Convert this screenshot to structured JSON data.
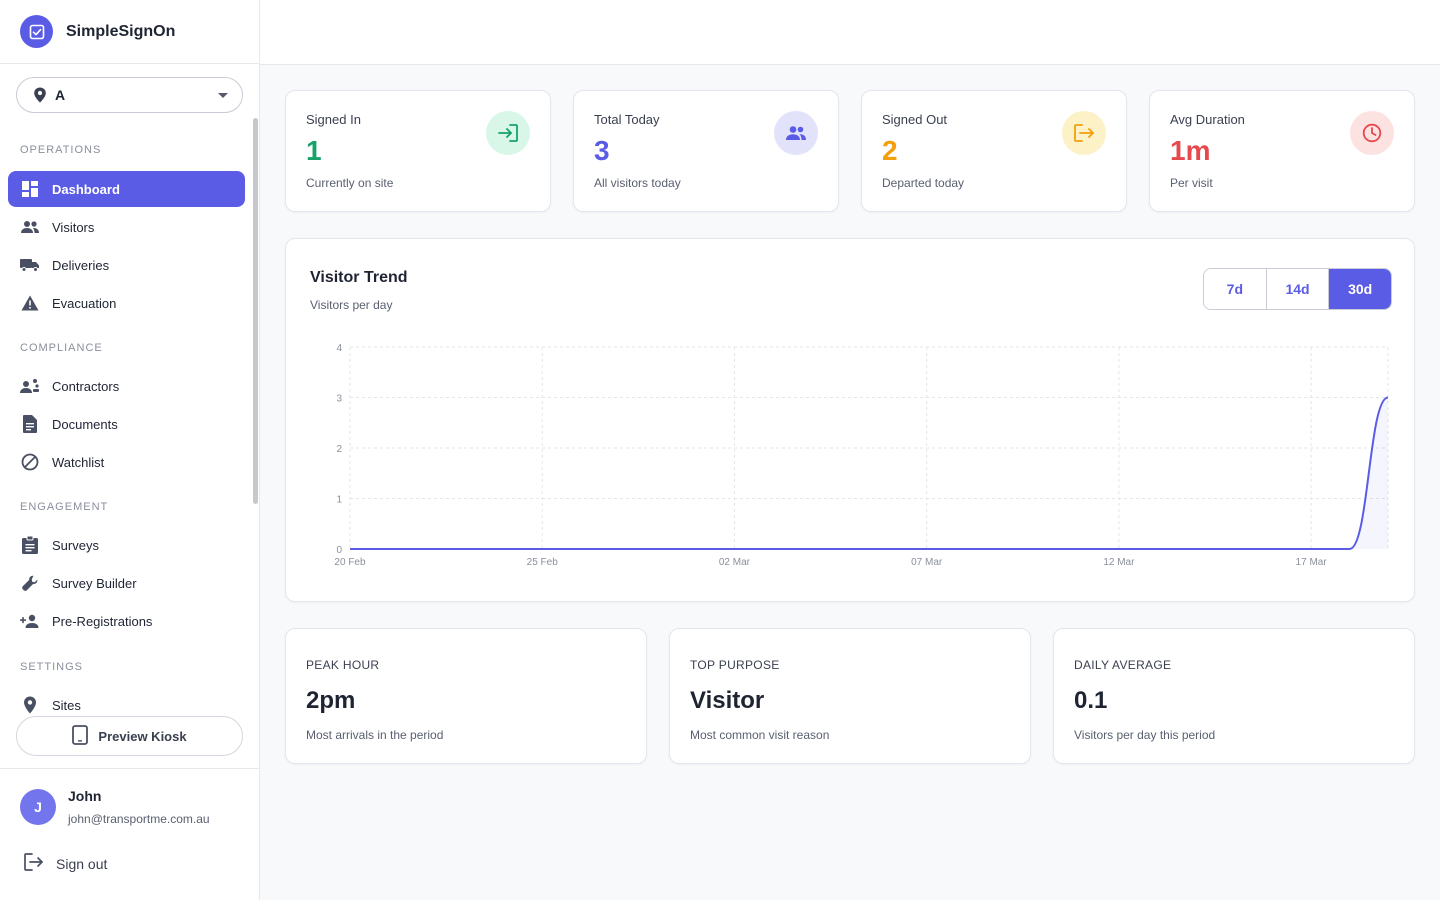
{
  "brand": {
    "name": "SimpleSignOn"
  },
  "site_selector": {
    "value": "A"
  },
  "nav": {
    "sections": {
      "operations": "OPERATIONS",
      "compliance": "COMPLIANCE",
      "engagement": "ENGAGEMENT",
      "settings": "SETTINGS"
    },
    "items": {
      "dashboard": "Dashboard",
      "visitors": "Visitors",
      "deliveries": "Deliveries",
      "evacuation": "Evacuation",
      "contractors": "Contractors",
      "documents": "Documents",
      "watchlist": "Watchlist",
      "surveys": "Surveys",
      "survey_builder": "Survey Builder",
      "pre_registrations": "Pre-Registrations",
      "sites": "Sites"
    },
    "active": "Dashboard"
  },
  "preview_kiosk": "Preview Kiosk",
  "user": {
    "initial": "J",
    "name": "John",
    "email": "john@transportme.com.au"
  },
  "sign_out": "Sign out",
  "stats": {
    "signed_in": {
      "title": "Signed In",
      "value": "1",
      "sub": "Currently on site",
      "color": "#16a36a",
      "bg": "#d9f7e8"
    },
    "total_today": {
      "title": "Total Today",
      "value": "3",
      "sub": "All visitors today",
      "color": "#5b5ce6",
      "bg": "#e2e3fb"
    },
    "signed_out": {
      "title": "Signed Out",
      "value": "2",
      "sub": "Departed today",
      "color": "#f29f0b",
      "bg": "#fdf2c7"
    },
    "avg_duration": {
      "title": "Avg Duration",
      "value": "1m",
      "sub": "Per visit",
      "color": "#e5484d",
      "bg": "#fde2e2"
    }
  },
  "trend": {
    "title": "Visitor Trend",
    "subtitle": "Visitors per day",
    "ranges": [
      "7d",
      "14d",
      "30d"
    ],
    "active_range": "30d"
  },
  "chart_data": {
    "type": "line",
    "x_ticks": [
      "20 Feb",
      "25 Feb",
      "02 Mar",
      "07 Mar",
      "12 Mar",
      "17 Mar"
    ],
    "y_ticks": [
      "0",
      "1",
      "2",
      "3",
      "4"
    ],
    "ylim": [
      0,
      4
    ],
    "x_start": "20 Feb",
    "x_end": "19 Mar",
    "series": [
      {
        "x": [
          "20 Feb",
          "21 Feb",
          "22 Feb",
          "23 Feb",
          "24 Feb",
          "25 Feb",
          "26 Feb",
          "27 Feb",
          "28 Feb",
          "01 Mar",
          "02 Mar",
          "03 Mar",
          "04 Mar",
          "05 Mar",
          "06 Mar",
          "07 Mar",
          "08 Mar",
          "09 Mar",
          "10 Mar",
          "11 Mar",
          "12 Mar",
          "13 Mar",
          "14 Mar",
          "15 Mar",
          "16 Mar",
          "17 Mar",
          "18 Mar",
          "19 Mar"
        ],
        "values": [
          0,
          0,
          0,
          0,
          0,
          0,
          0,
          0,
          0,
          0,
          0,
          0,
          0,
          0,
          0,
          0,
          0,
          0,
          0,
          0,
          0,
          0,
          0,
          0,
          0,
          0,
          0,
          3
        ]
      }
    ],
    "line_color": "#5b5ce6",
    "grid": true
  },
  "insights": {
    "peak_hour": {
      "label": "PEAK HOUR",
      "value": "2pm",
      "desc": "Most arrivals in the period"
    },
    "top_purpose": {
      "label": "TOP PURPOSE",
      "value": "Visitor",
      "desc": "Most common visit reason"
    },
    "daily_average": {
      "label": "DAILY AVERAGE",
      "value": "0.1",
      "desc": "Visitors per day this period"
    }
  }
}
